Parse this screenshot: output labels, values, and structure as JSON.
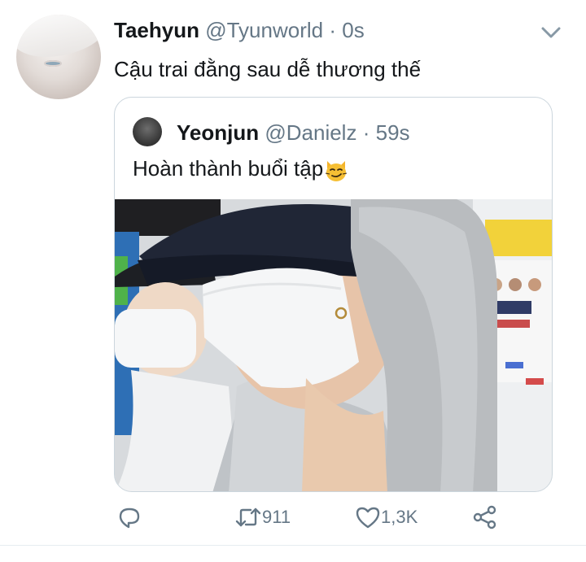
{
  "tweet": {
    "author_name": "Taehyun",
    "author_handle": "@Tyunworld",
    "separator": "·",
    "time": "0s",
    "text": "Cậu trai đằng sau dễ thương thế"
  },
  "quoted_tweet": {
    "author_name": "Yeonjun",
    "author_handle": "@Danielz",
    "separator": "·",
    "time": "59s",
    "text": "Hoàn thành buổi tập",
    "emoji": "smirking-cat-emoji"
  },
  "actions": {
    "reply_icon": "reply-icon",
    "retweet_icon": "retweet-icon",
    "retweet_count": "911",
    "like_icon": "heart-icon",
    "like_count": "1,3K",
    "share_icon": "share-icon"
  },
  "colors": {
    "text_primary": "#14171a",
    "text_secondary": "#657786",
    "border": "#ccd6dd"
  }
}
